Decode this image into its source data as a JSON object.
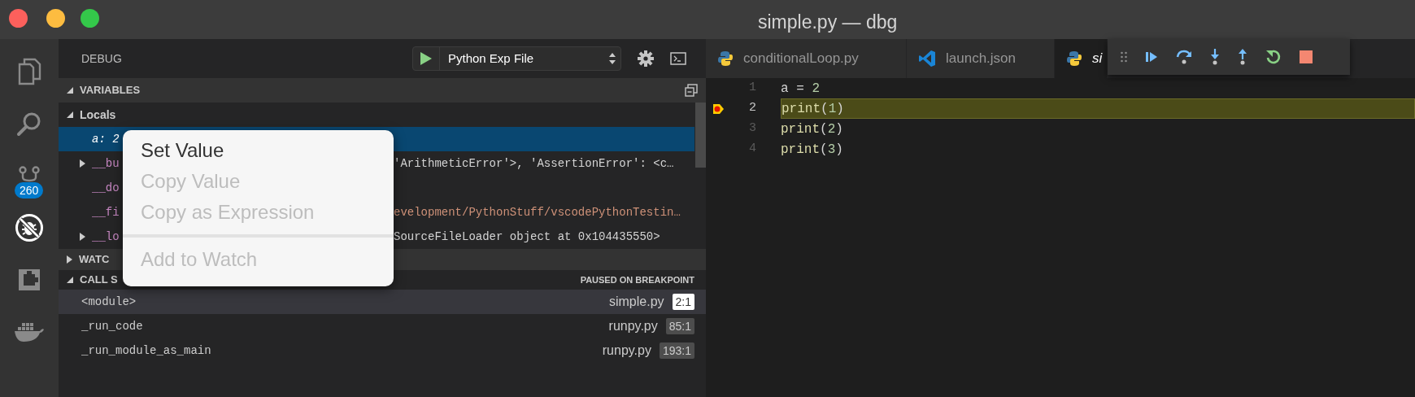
{
  "window": {
    "title": "simple.py — dbg"
  },
  "activity_bar": [
    {
      "kind": "files",
      "selected": false
    },
    {
      "kind": "search",
      "selected": false
    },
    {
      "kind": "git",
      "selected": false,
      "badge": "260"
    },
    {
      "kind": "debug",
      "selected": true
    },
    {
      "kind": "extensions",
      "selected": false
    },
    {
      "kind": "docker",
      "selected": false
    }
  ],
  "debug_header": {
    "title": "DEBUG",
    "configuration": "Python Exp File"
  },
  "variables": {
    "title": "VARIABLES",
    "expanded": true,
    "scopes": [
      {
        "name": "Locals",
        "expanded": true,
        "children": [
          {
            "name": "a: 2",
            "selected": true,
            "expandable": false
          },
          {
            "name": "__bu",
            "value": "'ArithmeticError'>, 'AssertionError': <c…",
            "kind": "object",
            "selected": false,
            "expandable": true
          },
          {
            "name": "__do",
            "selected": false,
            "expandable": false
          },
          {
            "name": "__fi",
            "value": "evelopment/PythonStuff/vscodePythonTestin…",
            "kind": "string",
            "selected": false,
            "expandable": false
          },
          {
            "name": "__lo",
            "value": "SourceFileLoader object at 0x104435550>",
            "kind": "object",
            "selected": false,
            "expandable": true
          }
        ]
      }
    ]
  },
  "watch": {
    "title": "WATC",
    "expanded": false
  },
  "call_stack": {
    "title": "CALL S",
    "expanded": true,
    "status": "PAUSED ON BREAKPOINT",
    "frames": [
      {
        "name": "<module>",
        "file": "simple.py",
        "position": "2:1",
        "selected": true
      },
      {
        "name": "_run_code",
        "file": "runpy.py",
        "position": "85:1",
        "selected": false
      },
      {
        "name": "_run_module_as_main",
        "file": "runpy.py",
        "position": "193:1",
        "selected": false
      }
    ]
  },
  "context_menu": [
    {
      "kind": "item",
      "label": "Set Value",
      "disabled": false
    },
    {
      "kind": "item",
      "label": "Copy Value",
      "disabled": true
    },
    {
      "kind": "item",
      "label": "Copy as Expression",
      "disabled": true
    },
    {
      "kind": "separator"
    },
    {
      "kind": "item",
      "label": "Add to Watch",
      "disabled": true
    }
  ],
  "editor": {
    "tabs": [
      {
        "label": "conditionalLoop.py",
        "kind": "python",
        "selected": false
      },
      {
        "label": "launch.json",
        "kind": "config",
        "selected": false
      },
      {
        "label": "si",
        "kind": "python",
        "selected": true
      }
    ],
    "debug_controls": [
      {
        "kind": "continue"
      },
      {
        "kind": "step_over"
      },
      {
        "kind": "step_into"
      },
      {
        "kind": "step_out"
      },
      {
        "kind": "restart"
      },
      {
        "kind": "stop"
      }
    ],
    "lines": [
      {
        "number": "1",
        "current": false,
        "tokens": [
          {
            "text": "a = ",
            "kind": "plain"
          },
          {
            "text": "2",
            "kind": "number"
          }
        ]
      },
      {
        "number": "2",
        "current": true,
        "tokens": [
          {
            "text": "print",
            "kind": "function"
          },
          {
            "text": "(",
            "kind": "plain"
          },
          {
            "text": "1",
            "kind": "number"
          },
          {
            "text": ")",
            "kind": "plain"
          }
        ]
      },
      {
        "number": "3",
        "current": false,
        "tokens": [
          {
            "text": "print",
            "kind": "function"
          },
          {
            "text": "(",
            "kind": "plain"
          },
          {
            "text": "2",
            "kind": "number"
          },
          {
            "text": ")",
            "kind": "plain"
          }
        ]
      },
      {
        "number": "4",
        "current": false,
        "tokens": [
          {
            "text": "print",
            "kind": "function"
          },
          {
            "text": "(",
            "kind": "plain"
          },
          {
            "text": "3",
            "kind": "number"
          },
          {
            "text": ")",
            "kind": "plain"
          }
        ]
      }
    ]
  }
}
